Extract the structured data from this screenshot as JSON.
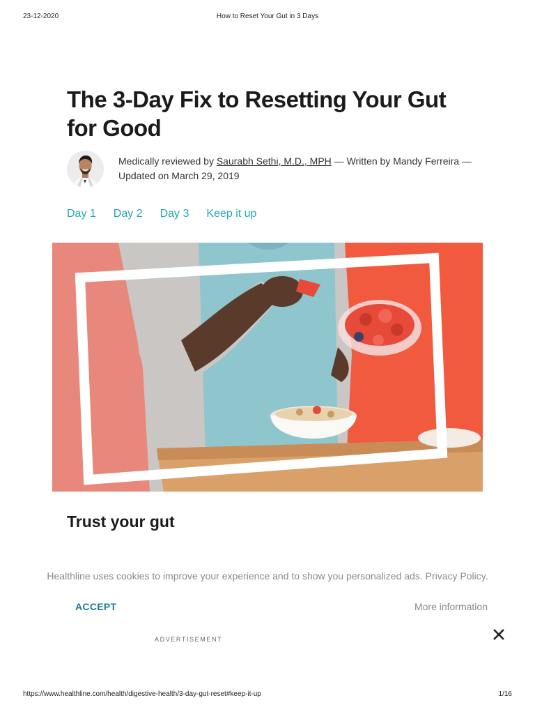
{
  "print_header": {
    "date": "23-12-2020",
    "title": "How to Reset Your Gut in 3 Days"
  },
  "article": {
    "title": "The 3-Day Fix to Resetting Your Gut for Good",
    "byline": {
      "prefix": "Medically reviewed by ",
      "reviewer": "Saurabh Sethi, M.D., MPH",
      "written_by": " — Written by Mandy Ferreira — Updated on March 29, 2019"
    },
    "day_nav": [
      "Day 1",
      "Day 2",
      "Day 3",
      "Keep it up"
    ],
    "section_heading": "Trust your gut"
  },
  "cookie_banner": {
    "text": "Healthline uses cookies to improve your experience and to show you personalized ads.",
    "privacy_link": "Privacy Policy.",
    "accept_label": "ACCEPT",
    "more_info_label": "More information"
  },
  "ad_label": "ADVERTISEMENT",
  "print_footer": {
    "url": "https://www.healthline.com/health/digestive-health/3-day-gut-reset#keep-it-up",
    "page": "1/16"
  },
  "colors": {
    "accent_link": "#1fa9b7",
    "accept_button": "#1a7c8c",
    "hero_red": "#f15a3f",
    "hero_salmon": "#e8877c"
  },
  "icons": [
    "close-icon"
  ]
}
